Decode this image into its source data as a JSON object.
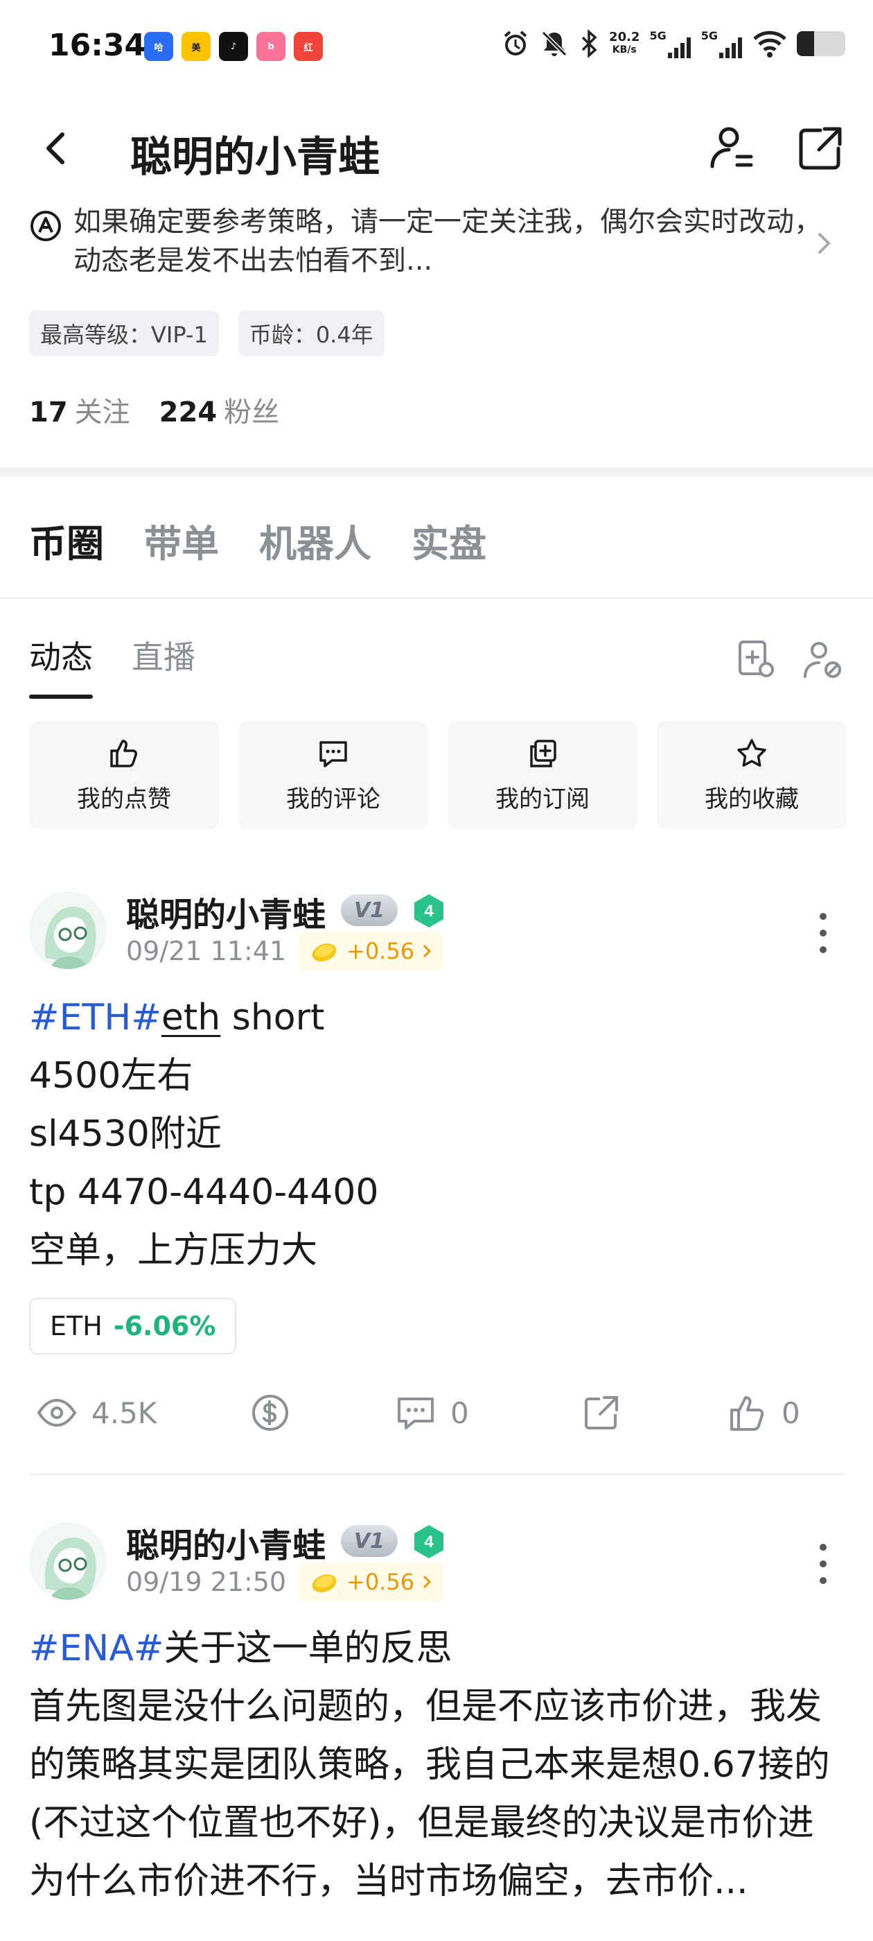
{
  "status_bar": {
    "time": "16:34",
    "apps": [
      {
        "name": "哈啰",
        "color": "#2b6df2"
      },
      {
        "name": "美团",
        "color": "#ffc300"
      },
      {
        "name": "抖音",
        "color": "#111111"
      },
      {
        "name": "bilibili",
        "color": "#fb7299"
      },
      {
        "name": "红包",
        "color": "#f0453a"
      }
    ],
    "speed_value": "20.2",
    "speed_unit": "KB/s",
    "net1": "5G",
    "net2": "5G",
    "battery_level": 0.35
  },
  "header": {
    "title": "聪明的小青蛙",
    "bio": "如果确定要参考策略，请一定一定关注我，偶尔会实时改动，动态老是发不出去怕看不到..."
  },
  "tags": [
    "最高等级：VIP-1",
    "币龄：0.4年"
  ],
  "stats": {
    "following_count": "17",
    "following_label": "关注",
    "followers_count": "224",
    "followers_label": "粉丝"
  },
  "main_tabs": [
    "币圈",
    "带单",
    "机器人",
    "实盘"
  ],
  "sub_tabs": [
    "动态",
    "直播"
  ],
  "quick_actions": [
    "我的点赞",
    "我的评论",
    "我的订阅",
    "我的收藏"
  ],
  "posts": [
    {
      "author": "聪明的小青蛙",
      "vip": "V1",
      "level": "4",
      "date": "09/21 11:41",
      "tip": "+0.56",
      "hashtag": "#ETH#",
      "tag_rest": "eth",
      "first_line_rest": " short",
      "body": "4500左右\nsl4530附近\ntp 4470-4440-4400\n空单，上方压力大",
      "coin": "ETH",
      "coin_change": "-6.06%",
      "views": "4.5K",
      "comments": "0",
      "likes": "0"
    },
    {
      "author": "聪明的小青蛙",
      "vip": "V1",
      "level": "4",
      "date": "09/19 21:50",
      "tip": "+0.56",
      "hashtag": "#ENA#",
      "first_line_rest": "关于这一单的反思",
      "body": "首先图是没什么问题的，但是不应该市价进，我发的策略其实是团队策略，我自己本来是想0.67接的(不过这个位置也不好)，但是最终的决议是市价进\n为什么市价进不行，当时市场偏空，去市价..."
    }
  ]
}
